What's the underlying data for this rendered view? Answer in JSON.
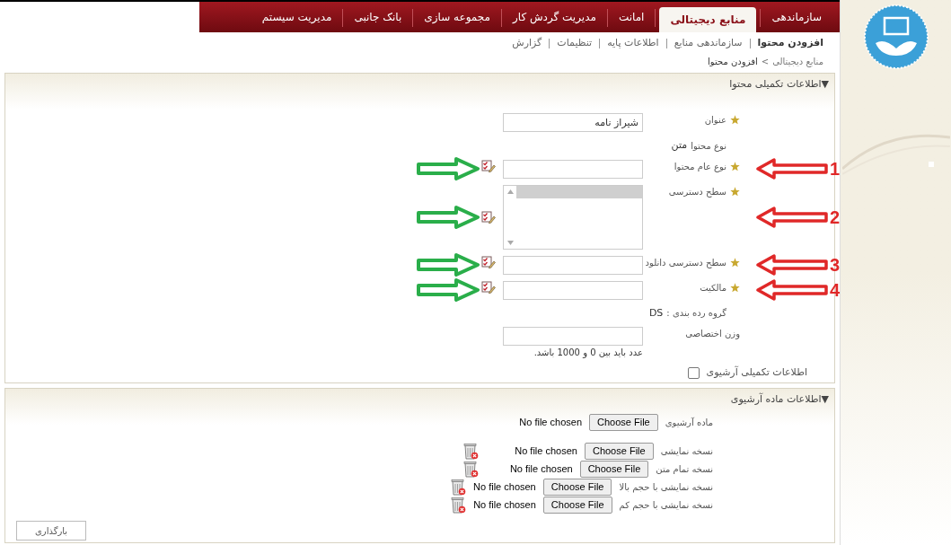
{
  "nav_tabs": [
    {
      "label": "سازماندهی",
      "selected": false
    },
    {
      "label": "منابع دیجیتالی",
      "selected": true
    },
    {
      "label": "امانت",
      "selected": false
    },
    {
      "label": "مدیریت گردش کار",
      "selected": false
    },
    {
      "label": "مجموعه سازی",
      "selected": false
    },
    {
      "label": "بانک جانبی",
      "selected": false
    },
    {
      "label": "مدیریت سیستم",
      "selected": false
    }
  ],
  "sub_nav": [
    {
      "label": "افزودن محتوا",
      "selected": true
    },
    {
      "label": "سازماندهی منابع",
      "selected": false
    },
    {
      "label": "اطلاعات پایه",
      "selected": false
    },
    {
      "label": "تنظیمات",
      "selected": false
    },
    {
      "label": "گزارش",
      "selected": false
    }
  ],
  "breadcrumb": {
    "parent": "منابع دیجیتالی",
    "separator": ">",
    "current": "افزودن محتوا"
  },
  "content_panel": {
    "title": "▼اطلاعات تکمیلی محتوا",
    "fields": [
      {
        "kind": "text",
        "label": "عنوان",
        "required": true,
        "value": "شیراز نامه"
      },
      {
        "kind": "static",
        "label": "نوع محتوا",
        "value": "متن"
      },
      {
        "kind": "text",
        "label": "نوع عام محتوا",
        "required": true,
        "lookup": true,
        "callout": "1"
      },
      {
        "kind": "list",
        "label": "سطح دسترسی",
        "required": true,
        "lookup": true,
        "callout": "2"
      },
      {
        "kind": "text",
        "label": "سطح دسترسی دانلود",
        "required": true,
        "lookup": true,
        "callout": "3"
      },
      {
        "kind": "text",
        "label": "مالکیت",
        "required": true,
        "lookup": true,
        "callout": "4"
      },
      {
        "kind": "static",
        "label": "گروه رده بندی :",
        "value": "DS"
      },
      {
        "kind": "text",
        "label": "وزن اختصاصی",
        "required": false,
        "hint": "عدد باید بین 0 و 1000 باشد."
      },
      {
        "kind": "checkbox",
        "label": "اطلاعات تکمیلی آرشیوی",
        "checked": false
      }
    ]
  },
  "archive_panel": {
    "title": "▼اطلاعات ماده آرشیوی",
    "files": [
      {
        "label": "ماده آرشیوی",
        "button": "Choose File",
        "status": "No file chosen",
        "deletable": false
      },
      {
        "label": "نسخه نمایشی",
        "button": "Choose File",
        "status": "No file chosen",
        "deletable": true
      },
      {
        "label": "نسخه تمام متن",
        "button": "Choose File",
        "status": "No file chosen",
        "deletable": true
      },
      {
        "label": "نسخه نمایشی با حجم بالا",
        "button": "Choose File",
        "status": "No file chosen",
        "deletable": true
      },
      {
        "label": "نسخه نمایشی با حجم کم",
        "button": "Choose File",
        "status": "No file chosen",
        "deletable": true
      }
    ],
    "upload_button": "بارگذاری"
  }
}
